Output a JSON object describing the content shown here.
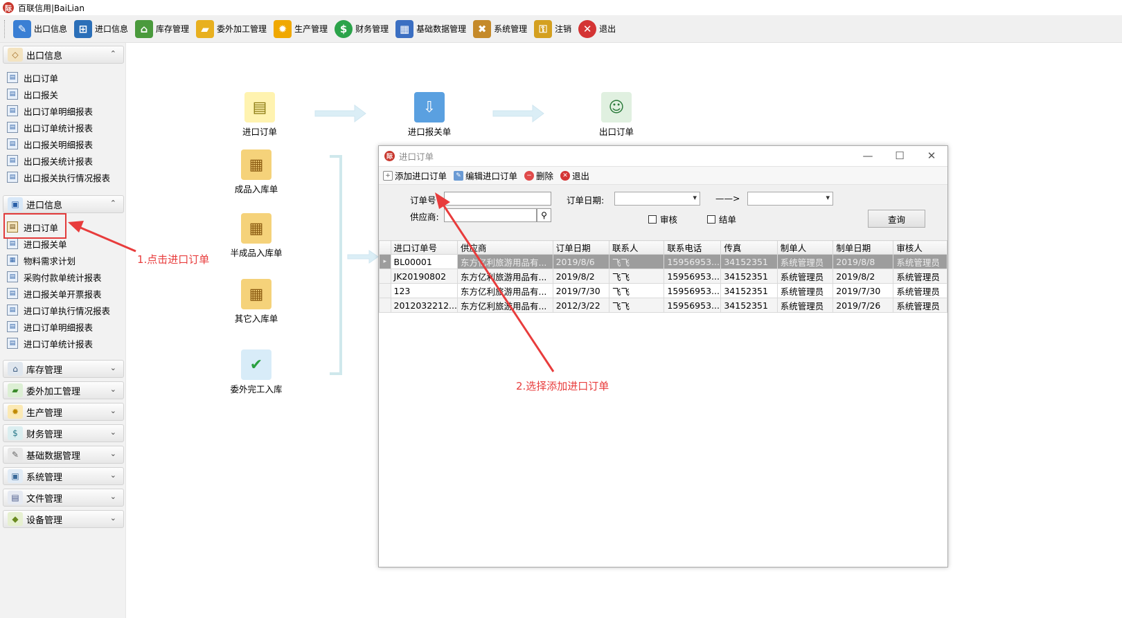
{
  "app": {
    "title": "百联信用|BaiLian",
    "logo_text": "际"
  },
  "toolbar": {
    "items": [
      {
        "label": "出口信息",
        "icon": "pencil-note-icon",
        "color": "#3a7fd4"
      },
      {
        "label": "进口信息",
        "icon": "basket-icon",
        "color": "#2b6fb8"
      },
      {
        "label": "库存管理",
        "icon": "warehouse-icon",
        "color": "#4a9a3c"
      },
      {
        "label": "委外加工管理",
        "icon": "folder-open-icon",
        "color": "#e8b020"
      },
      {
        "label": "生产管理",
        "icon": "gears-icon",
        "color": "#f0a800"
      },
      {
        "label": "财务管理",
        "icon": "dollar-icon",
        "color": "#2ba34a"
      },
      {
        "label": "基础数据管理",
        "icon": "table-grid-icon",
        "color": "#3b6fc2"
      },
      {
        "label": "系统管理",
        "icon": "boxes-tools-icon",
        "color": "#c58a2a"
      },
      {
        "label": "注销",
        "icon": "key-icon",
        "color": "#d4a020"
      },
      {
        "label": "退出",
        "icon": "close-circle-icon",
        "color": "#d43434"
      }
    ]
  },
  "sidebar": {
    "export_group": {
      "label": "出口信息",
      "chevron": "⌃"
    },
    "export_items": [
      "出口订单",
      "出口报关",
      "出口订单明细报表",
      "出口订单统计报表",
      "出口报关明细报表",
      "出口报关统计报表",
      "出口报关执行情况报表"
    ],
    "import_group": {
      "label": "进口信息",
      "chevron": "⌃"
    },
    "import_items": [
      "进口订单",
      "进口报关单",
      "物料需求计划",
      "采购付款单统计报表",
      "进口报关单开票报表",
      "进口订单执行情况报表",
      "进口订单明细报表",
      "进口订单统计报表"
    ],
    "collapsed_groups": [
      "库存管理",
      "委外加工管理",
      "生产管理",
      "财务管理",
      "基础数据管理",
      "系统管理",
      "文件管理",
      "设备管理"
    ],
    "collapsed_chevron": "⌄"
  },
  "annotations": {
    "step1": "1.点击进口订单",
    "step2": "2.选择添加进口订单",
    "accent": "#e83c3c"
  },
  "flow": {
    "top": [
      "进口订单",
      "进口报关单",
      "出口订单"
    ],
    "stock": [
      "成品入库单",
      "半成品入库单",
      "其它入库单",
      "委外完工入库"
    ]
  },
  "dialog": {
    "title": "进口订单",
    "controls": {
      "minimize": "—",
      "maximize": "☐",
      "close": "✕"
    },
    "toolbar": [
      "添加进口订单",
      "编辑进口订单",
      "删除",
      "退出"
    ],
    "form": {
      "order_no_label": "订单号",
      "order_no_value": "",
      "supplier_label": "供应商:",
      "supplier_value": "",
      "date_label": "订单日期:",
      "date_from": "",
      "date_to": "",
      "range_arrow": "——>",
      "audited_label": "审核",
      "settled_label": "结单",
      "query_button": "查询"
    },
    "table": {
      "columns": [
        "进口订单号",
        "供应商",
        "订单日期",
        "联系人",
        "联系电话",
        "传真",
        "制单人",
        "制单日期",
        "审核人"
      ],
      "rows": [
        [
          "BL00001",
          "东方亿利旅游用品有...",
          "2019/8/6",
          "飞飞",
          "15956953...",
          "34152351",
          "系统管理员",
          "2019/8/8",
          "系统管理员"
        ],
        [
          "JK20190802",
          "东方亿利旅游用品有...",
          "2019/8/2",
          "飞飞",
          "15956953...",
          "34152351",
          "系统管理员",
          "2019/8/2",
          "系统管理员"
        ],
        [
          "123",
          "东方亿利旅游用品有...",
          "2019/7/30",
          "飞飞",
          "15956953...",
          "34152351",
          "系统管理员",
          "2019/7/30",
          "系统管理员"
        ],
        [
          "2012032212...",
          "东方亿利旅游用品有...",
          "2012/3/22",
          "飞飞",
          "15956953...",
          "34152351",
          "系统管理员",
          "2019/7/26",
          "系统管理员"
        ]
      ]
    }
  }
}
